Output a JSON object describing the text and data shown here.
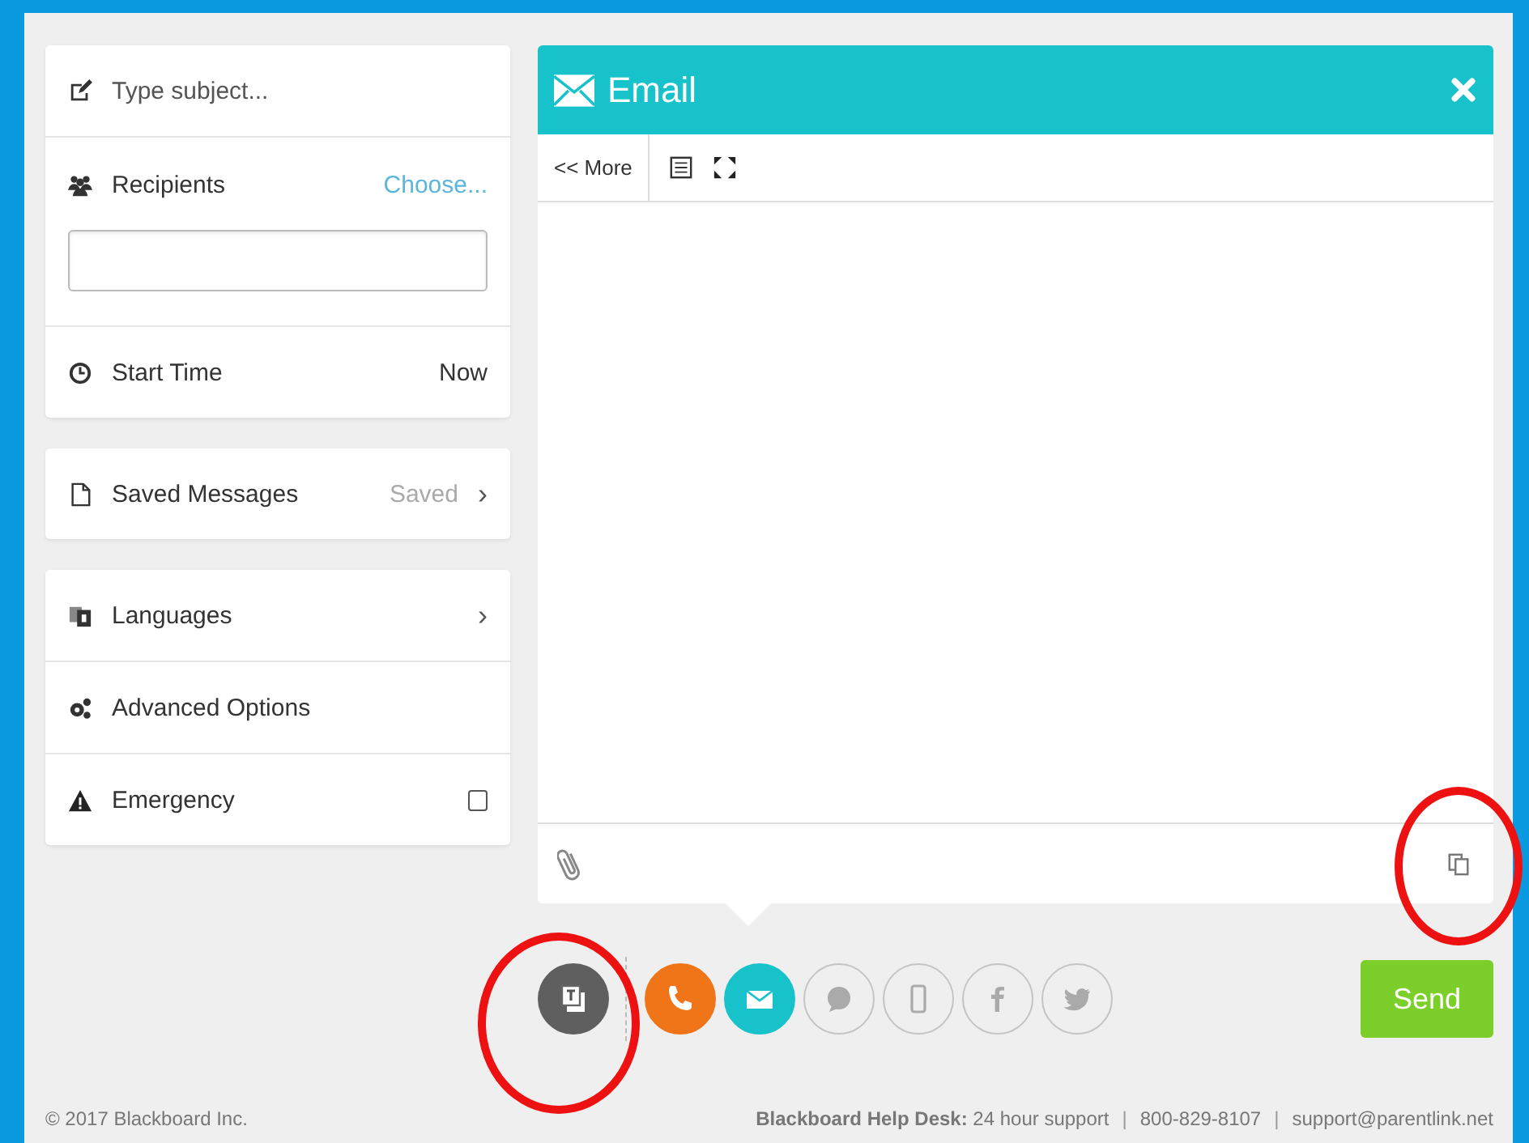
{
  "sidebar": {
    "cards": [
      {
        "rows": [
          {
            "kind": "subject",
            "placeholder": "Type subject..."
          },
          {
            "kind": "recipients",
            "label": "Recipients",
            "link": "Choose..."
          },
          {
            "kind": "start_time",
            "label": "Start Time",
            "value": "Now"
          }
        ]
      },
      {
        "rows": [
          {
            "kind": "saved_messages",
            "label": "Saved Messages",
            "hint": "Saved",
            "arrow": "›"
          }
        ]
      },
      {
        "rows": [
          {
            "kind": "languages",
            "label": "Languages",
            "arrow": "›"
          },
          {
            "kind": "advanced",
            "label": "Advanced Options"
          },
          {
            "kind": "emergency",
            "label": "Emergency",
            "checked": false
          }
        ]
      }
    ]
  },
  "editor": {
    "title": "Email",
    "more": "<< More"
  },
  "channels": [
    {
      "kind": "phone",
      "on": true,
      "color": "#f07418"
    },
    {
      "kind": "email",
      "on": true,
      "color": "#17c2cb"
    },
    {
      "kind": "chat",
      "on": false,
      "color": "#c4c4c4"
    },
    {
      "kind": "mobile",
      "on": false,
      "color": "#c4c4c4"
    },
    {
      "kind": "facebook",
      "on": false,
      "color": "#c4c4c4"
    },
    {
      "kind": "twitter",
      "on": false,
      "color": "#c4c4c4"
    }
  ],
  "send": "Send",
  "footer": {
    "copyright": "© 2017 Blackboard Inc.",
    "helpdesk_label": "Blackboard Help Desk:",
    "hours": "24 hour support",
    "sep_1": "|",
    "phone": "800-829-8107",
    "sep_2": "|",
    "email": "support@parentlink.net"
  }
}
